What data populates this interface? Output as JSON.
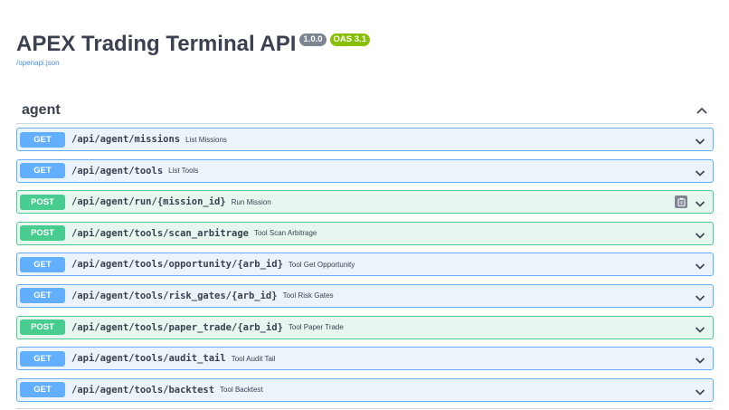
{
  "info": {
    "title": "APEX Trading Terminal API",
    "version": "1.0.0",
    "oas": "OAS 3.1",
    "spec_link": "/openapi.json"
  },
  "tag": {
    "name": "agent",
    "toggle_icon": "chevron-up-icon"
  },
  "operations": [
    {
      "method": "GET",
      "path": "/api/agent/missions",
      "summary": "List Missions"
    },
    {
      "method": "GET",
      "path": "/api/agent/tools",
      "summary": "List Tools"
    },
    {
      "method": "POST",
      "path": "/api/agent/run/{mission_id}",
      "summary": "Run Mission",
      "copy_icon": "clipboard-icon"
    },
    {
      "method": "POST",
      "path": "/api/agent/tools/scan_arbitrage",
      "summary": "Tool Scan Arbitrage"
    },
    {
      "method": "GET",
      "path": "/api/agent/tools/opportunity/{arb_id}",
      "summary": "Tool Get Opportunity"
    },
    {
      "method": "GET",
      "path": "/api/agent/tools/risk_gates/{arb_id}",
      "summary": "Tool Risk Gates"
    },
    {
      "method": "POST",
      "path": "/api/agent/tools/paper_trade/{arb_id}",
      "summary": "Tool Paper Trade"
    },
    {
      "method": "GET",
      "path": "/api/agent/tools/audit_tail",
      "summary": "Tool Audit Tail"
    },
    {
      "method": "GET",
      "path": "/api/agent/tools/backtest",
      "summary": "Tool Backtest"
    }
  ],
  "colors": {
    "get": "#61affe",
    "post": "#49cc90",
    "version_badge": "#7d8492",
    "oas_badge": "#89bf04"
  }
}
